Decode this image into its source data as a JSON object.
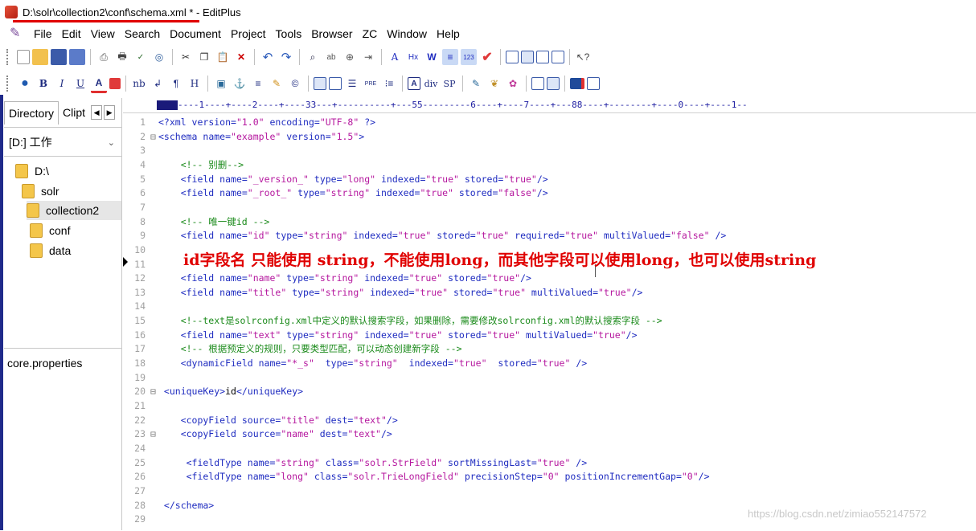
{
  "window": {
    "title": "D:\\solr\\collection2\\conf\\schema.xml * - EditPlus"
  },
  "menu": [
    "File",
    "Edit",
    "View",
    "Search",
    "Document",
    "Project",
    "Tools",
    "Browser",
    "ZC",
    "Window",
    "Help"
  ],
  "toolbar1_icons": [
    "new-file-icon",
    "open-file-icon",
    "save-icon",
    "save-all-icon",
    "print-preview-icon",
    "print-icon",
    "spellcheck-icon",
    "html-preview-icon",
    "cut-icon",
    "copy-icon",
    "paste-icon",
    "delete-icon",
    "undo-icon",
    "redo-icon",
    "find-icon",
    "replace-icon",
    "find-in-files-icon",
    "goto-line-icon",
    "font-icon",
    "hex-icon",
    "word-wrap-icon",
    "ruler-icon",
    "line-number-icon",
    "check-icon",
    "view-icon-1",
    "view-icon-2",
    "view-icon-3",
    "view-icon-4",
    "help-icon"
  ],
  "toolbar2_icons": [
    "browser-icon",
    "bold-icon",
    "italic-icon",
    "underline-icon",
    "font-color-icon",
    "table-icon",
    "nbsp-icon",
    "line-break-icon",
    "paragraph-icon",
    "heading-icon",
    "image-icon",
    "anchor-icon",
    "hr-icon",
    "edit-icon",
    "copyright-icon",
    "table2-icon",
    "form-icon",
    "list-icon",
    "pre-icon",
    "ul-icon",
    "a-tag-icon",
    "div-icon",
    "span-icon",
    "edit2-icon",
    "css-icon",
    "color-picker-icon",
    "frame-icon",
    "tag-icon",
    "stop-icon",
    "window-icon"
  ],
  "toolbar2_labels": {
    "bold": "B",
    "italic": "I",
    "underline": "U",
    "nbsp": "nb",
    "heading": "H",
    "pre": "PRE",
    "div": "div",
    "sp": "SP"
  },
  "sidebar": {
    "tabs": [
      "Directory",
      "Clipt"
    ],
    "drive": "[D:] 工作",
    "folders": [
      "D:\\",
      "solr",
      "collection2",
      "conf",
      "data"
    ],
    "selected_folder": "collection2",
    "files": [
      "core.properties"
    ]
  },
  "editor": {
    "ruler": "----1----+----2----+----33---+----------+---55---------6----+----7----+---88----+--------+----0----+----1--",
    "lines": [
      {
        "n": "1",
        "fold": "",
        "parts": [
          [
            "tag",
            "<?xml "
          ],
          [
            "attr",
            "version="
          ],
          [
            "val",
            "\"1.0\""
          ],
          [
            "attr",
            " encoding="
          ],
          [
            "val",
            "\"UTF-8\""
          ],
          [
            "tag",
            " ?>"
          ]
        ]
      },
      {
        "n": "2",
        "fold": "⊟",
        "parts": [
          [
            "tag",
            "<schema "
          ],
          [
            "attr",
            "name="
          ],
          [
            "val",
            "\"example\""
          ],
          [
            "attr",
            " version="
          ],
          [
            "val",
            "\"1.5\""
          ],
          [
            "tag",
            ">"
          ]
        ]
      },
      {
        "n": "3",
        "fold": "",
        "parts": []
      },
      {
        "n": "4",
        "fold": "",
        "parts": [
          [
            "cm",
            "    <!-- 别删-->"
          ]
        ]
      },
      {
        "n": "5",
        "fold": "",
        "parts": [
          [
            "tag",
            "    <field "
          ],
          [
            "attr",
            "name="
          ],
          [
            "val",
            "\"_version_\""
          ],
          [
            "attr",
            " type="
          ],
          [
            "val",
            "\"long\""
          ],
          [
            "attr",
            " indexed="
          ],
          [
            "val",
            "\"true\""
          ],
          [
            "attr",
            " stored="
          ],
          [
            "val",
            "\"true\""
          ],
          [
            "tag",
            "/>"
          ]
        ]
      },
      {
        "n": "6",
        "fold": "",
        "parts": [
          [
            "tag",
            "    <field "
          ],
          [
            "attr",
            "name="
          ],
          [
            "val",
            "\"_root_\""
          ],
          [
            "attr",
            " type="
          ],
          [
            "val",
            "\"string\""
          ],
          [
            "attr",
            " indexed="
          ],
          [
            "val",
            "\"true\""
          ],
          [
            "attr",
            " stored="
          ],
          [
            "val",
            "\"false\""
          ],
          [
            "tag",
            "/>"
          ]
        ]
      },
      {
        "n": "7",
        "fold": "",
        "parts": []
      },
      {
        "n": "8",
        "fold": "",
        "parts": [
          [
            "cm",
            "    <!-- 唯一键id -->"
          ]
        ]
      },
      {
        "n": "9",
        "fold": "",
        "parts": [
          [
            "tag",
            "    <field "
          ],
          [
            "attr",
            "name="
          ],
          [
            "val",
            "\"id\""
          ],
          [
            "attr",
            " type="
          ],
          [
            "val",
            "\"string\""
          ],
          [
            "attr",
            " indexed="
          ],
          [
            "val",
            "\"true\""
          ],
          [
            "attr",
            " stored="
          ],
          [
            "val",
            "\"true\""
          ],
          [
            "attr",
            " required="
          ],
          [
            "val",
            "\"true\""
          ],
          [
            "attr",
            " multiValued="
          ],
          [
            "val",
            "\"false\""
          ],
          [
            "tag",
            " />"
          ]
        ]
      },
      {
        "n": "10",
        "fold": "",
        "parts": []
      },
      {
        "n": "11",
        "fold": "",
        "parts": []
      },
      {
        "n": "12",
        "fold": "",
        "parts": [
          [
            "tag",
            "    <field "
          ],
          [
            "attr",
            "name="
          ],
          [
            "val",
            "\"name\""
          ],
          [
            "attr",
            " type="
          ],
          [
            "val",
            "\"string\""
          ],
          [
            "attr",
            " indexed="
          ],
          [
            "val",
            "\"true\""
          ],
          [
            "attr",
            " stored="
          ],
          [
            "val",
            "\"true\""
          ],
          [
            "tag",
            "/>"
          ]
        ]
      },
      {
        "n": "13",
        "fold": "",
        "parts": [
          [
            "tag",
            "    <field "
          ],
          [
            "attr",
            "name="
          ],
          [
            "val",
            "\"title\""
          ],
          [
            "attr",
            " type="
          ],
          [
            "val",
            "\"string\""
          ],
          [
            "attr",
            " indexed="
          ],
          [
            "val",
            "\"true\""
          ],
          [
            "attr",
            " stored="
          ],
          [
            "val",
            "\"true\""
          ],
          [
            "attr",
            " multiValued="
          ],
          [
            "val",
            "\"true\""
          ],
          [
            "tag",
            "/>"
          ]
        ]
      },
      {
        "n": "14",
        "fold": "",
        "parts": []
      },
      {
        "n": "15",
        "fold": "",
        "parts": [
          [
            "cm",
            "    <!--text是solrconfig.xml中定义的默认搜索字段，如果删除，需要修改solrconfig.xml的默认搜索字段 -->"
          ]
        ]
      },
      {
        "n": "16",
        "fold": "",
        "parts": [
          [
            "tag",
            "    <field "
          ],
          [
            "attr",
            "name="
          ],
          [
            "val",
            "\"text\""
          ],
          [
            "attr",
            " type="
          ],
          [
            "val",
            "\"string\""
          ],
          [
            "attr",
            " indexed="
          ],
          [
            "val",
            "\"true\""
          ],
          [
            "attr",
            " stored="
          ],
          [
            "val",
            "\"true\""
          ],
          [
            "attr",
            " multiValued="
          ],
          [
            "val",
            "\"true\""
          ],
          [
            "tag",
            "/>"
          ]
        ]
      },
      {
        "n": "17",
        "fold": "",
        "parts": [
          [
            "cm",
            "    <!-- 根据预定义的规则，只要类型匹配，可以动态创建新字段 -->"
          ]
        ]
      },
      {
        "n": "18",
        "fold": "",
        "parts": [
          [
            "tag",
            "    <dynamicField "
          ],
          [
            "attr",
            "name="
          ],
          [
            "val",
            "\"*_s\""
          ],
          [
            "attr",
            "  type="
          ],
          [
            "val",
            "\"string\""
          ],
          [
            "attr",
            "  indexed="
          ],
          [
            "val",
            "\"true\""
          ],
          [
            "attr",
            "  stored="
          ],
          [
            "val",
            "\"true\""
          ],
          [
            "tag",
            " />"
          ]
        ]
      },
      {
        "n": "19",
        "fold": "",
        "parts": []
      },
      {
        "n": "20",
        "fold": "⊟",
        "parts": [
          [
            "tag",
            " <uniqueKey>"
          ],
          [
            "txt",
            "id"
          ],
          [
            "tag",
            "</uniqueKey>"
          ]
        ]
      },
      {
        "n": "21",
        "fold": "",
        "parts": []
      },
      {
        "n": "22",
        "fold": "",
        "parts": [
          [
            "tag",
            "    <copyField "
          ],
          [
            "attr",
            "source="
          ],
          [
            "val",
            "\"title\""
          ],
          [
            "attr",
            " dest="
          ],
          [
            "val",
            "\"text\""
          ],
          [
            "tag",
            "/>"
          ]
        ]
      },
      {
        "n": "23",
        "fold": "⊟",
        "parts": [
          [
            "tag",
            "    <copyField "
          ],
          [
            "attr",
            "source="
          ],
          [
            "val",
            "\"name\""
          ],
          [
            "attr",
            " dest="
          ],
          [
            "val",
            "\"text\""
          ],
          [
            "tag",
            "/>"
          ]
        ]
      },
      {
        "n": "24",
        "fold": "",
        "parts": []
      },
      {
        "n": "25",
        "fold": "",
        "parts": [
          [
            "tag",
            "     <fieldType "
          ],
          [
            "attr",
            "name="
          ],
          [
            "val",
            "\"string\""
          ],
          [
            "attr",
            " class="
          ],
          [
            "val",
            "\"solr.StrField\""
          ],
          [
            "attr",
            " sortMissingLast="
          ],
          [
            "val",
            "\"true\""
          ],
          [
            "tag",
            " />"
          ]
        ]
      },
      {
        "n": "26",
        "fold": "",
        "parts": [
          [
            "tag",
            "     <fieldType "
          ],
          [
            "attr",
            "name="
          ],
          [
            "val",
            "\"long\""
          ],
          [
            "attr",
            " class="
          ],
          [
            "val",
            "\"solr.TrieLongField\""
          ],
          [
            "attr",
            " precisionStep="
          ],
          [
            "val",
            "\"0\""
          ],
          [
            "attr",
            " positionIncrementGap="
          ],
          [
            "val",
            "\"0\""
          ],
          [
            "tag",
            "/>"
          ]
        ]
      },
      {
        "n": "27",
        "fold": "",
        "parts": []
      },
      {
        "n": "28",
        "fold": "",
        "parts": [
          [
            "tag",
            " </schema>"
          ]
        ]
      },
      {
        "n": "29",
        "fold": "",
        "parts": []
      }
    ]
  },
  "annotation": "id字段名 只能使用 string，不能使用long，而其他字段可以使用long，也可以使用string",
  "watermark": "https://blog.csdn.net/zimiao552147572",
  "colors": {
    "tag": "#1f2cc0",
    "value": "#b5179e",
    "comment": "#1a8a1a",
    "annotation": "#e00000"
  }
}
